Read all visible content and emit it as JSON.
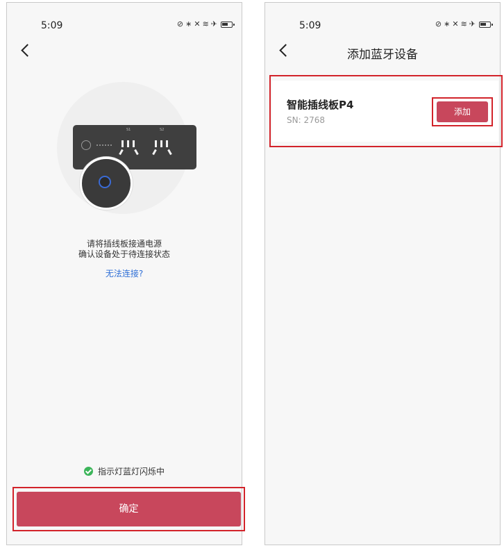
{
  "left_screen": {
    "status_time": "5:09",
    "illustration": {
      "socket_labels": [
        "S1",
        "S2"
      ]
    },
    "instructions": [
      "请将插线板接通电源",
      "确认设备处于待连接状态"
    ],
    "cant_connect_link": "无法连接?",
    "indicator_text": "指示灯蓝灯闪烁中",
    "confirm_button": "确定"
  },
  "right_screen": {
    "status_time": "5:09",
    "title": "添加蓝牙设备",
    "device": {
      "name": "智能插线板P4",
      "sn": "SN:  2768",
      "add_button": "添加"
    }
  },
  "icons": [
    "back-icon",
    "check-icon",
    "battery-icon",
    "wifi-icon",
    "airplane-icon",
    "bluetooth-icon",
    "mute-icon",
    "nfc-icon"
  ],
  "colors": {
    "accent": "#c8475c",
    "link": "#2f6fd6",
    "success": "#3cb55a",
    "highlight": "#d2232a"
  }
}
